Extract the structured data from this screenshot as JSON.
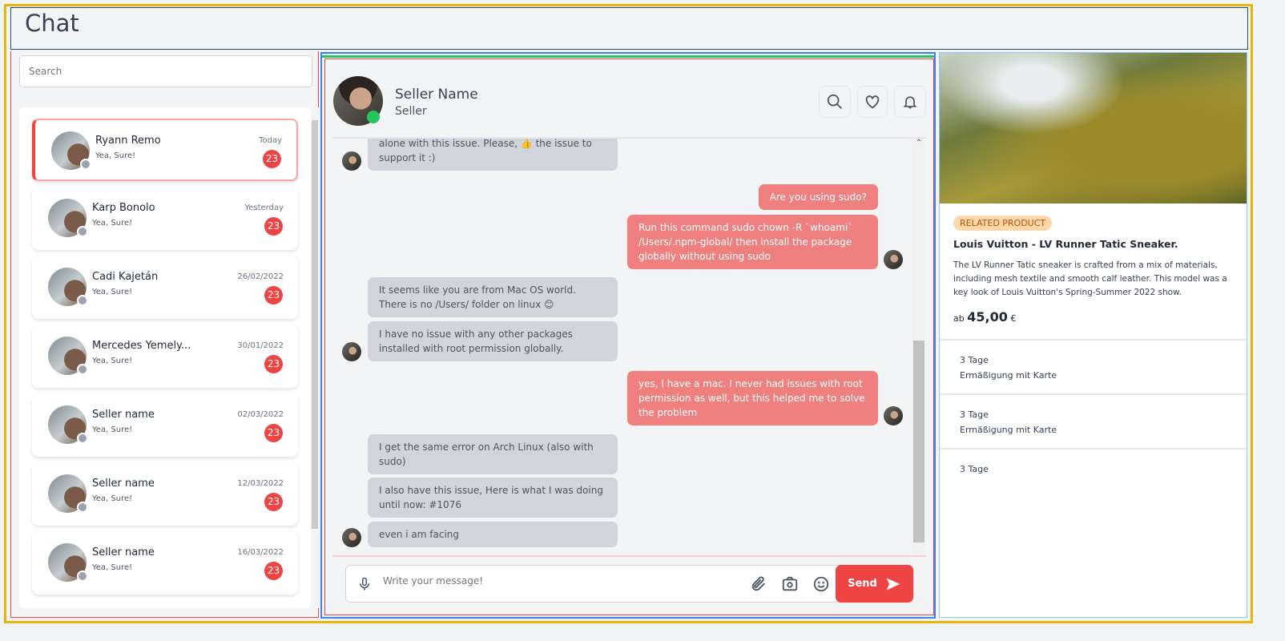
{
  "header": {
    "title": "Chat"
  },
  "sidebar": {
    "search_placeholder": "Search",
    "conversations": [
      {
        "name": "Ryann Remo",
        "preview": "Yea, Sure!",
        "date": "Today",
        "unread": "23",
        "active": true
      },
      {
        "name": "Karp Bonolo",
        "preview": "Yea, Sure!",
        "date": "Yesterday",
        "unread": "23"
      },
      {
        "name": "Cadi Kajetán",
        "preview": "Yea, Sure!",
        "date": "26/02/2022",
        "unread": "23"
      },
      {
        "name": "Mercedes Yemely...",
        "preview": "Yea, Sure!",
        "date": "30/01/2022",
        "unread": "23"
      },
      {
        "name": "Seller name",
        "preview": "Yea, Sure!",
        "date": "02/03/2022",
        "unread": "23"
      },
      {
        "name": "Seller name",
        "preview": "Yea, Sure!",
        "date": "12/03/2022",
        "unread": "23"
      },
      {
        "name": "Seller name",
        "preview": "Yea, Sure!",
        "date": "16/03/2022",
        "unread": "23"
      }
    ]
  },
  "chat": {
    "contact": {
      "name": "Seller Name",
      "role": "Seller",
      "status": "online"
    },
    "header_icons": [
      "search-icon",
      "heart-icon",
      "bell-icon"
    ],
    "messages": [
      {
        "from": "them",
        "text": "alone with this issue. Please, 👍 the issue to support it :)"
      },
      {
        "from": "me",
        "text": "Are you using sudo?"
      },
      {
        "from": "me",
        "text": "Run this command sudo chown -R `whoami` /Users/.npm-global/ then install the package globally without using sudo"
      },
      {
        "from": "them",
        "text": "It seems like you are from Mac OS world. There is no /Users/ folder on linux 😊"
      },
      {
        "from": "them",
        "text": "I have no issue with any other packages installed with root permission globally."
      },
      {
        "from": "me",
        "text": "yes, I have a mac. I never had issues with root permission as well, but this helped me to solve the problem"
      },
      {
        "from": "them",
        "text": "I get the same error on Arch Linux (also with sudo)"
      },
      {
        "from": "them",
        "text": "I also have this issue, Here is what I was doing until now: #1076"
      },
      {
        "from": "them",
        "text": "even i am facing"
      }
    ],
    "input_placeholder": "Write your message!",
    "send_label": "Send"
  },
  "product": {
    "tag": "RELATED PRODUCT",
    "title": "Louis Vuitton - LV Runner Tatic Sneaker.",
    "description": "The LV Runner Tatic sneaker is crafted from a mix of materials, including mesh textile and smooth calf leather. This model was a key look of Louis Vuitton's Spring-Summer 2022 show.",
    "price_prefix": "ab",
    "price": "45,00",
    "currency": "€",
    "options": [
      {
        "days": "3 Tage",
        "note": "Ermäßigung mit Karte"
      },
      {
        "days": "3 Tage",
        "note": "Ermäßigung mit Karte"
      },
      {
        "days": "3 Tage"
      }
    ]
  },
  "colors": {
    "accent": "#ef4444",
    "sent_bubble": "#f08080",
    "received_bubble": "#d1d5db",
    "online": "#22c55e"
  }
}
